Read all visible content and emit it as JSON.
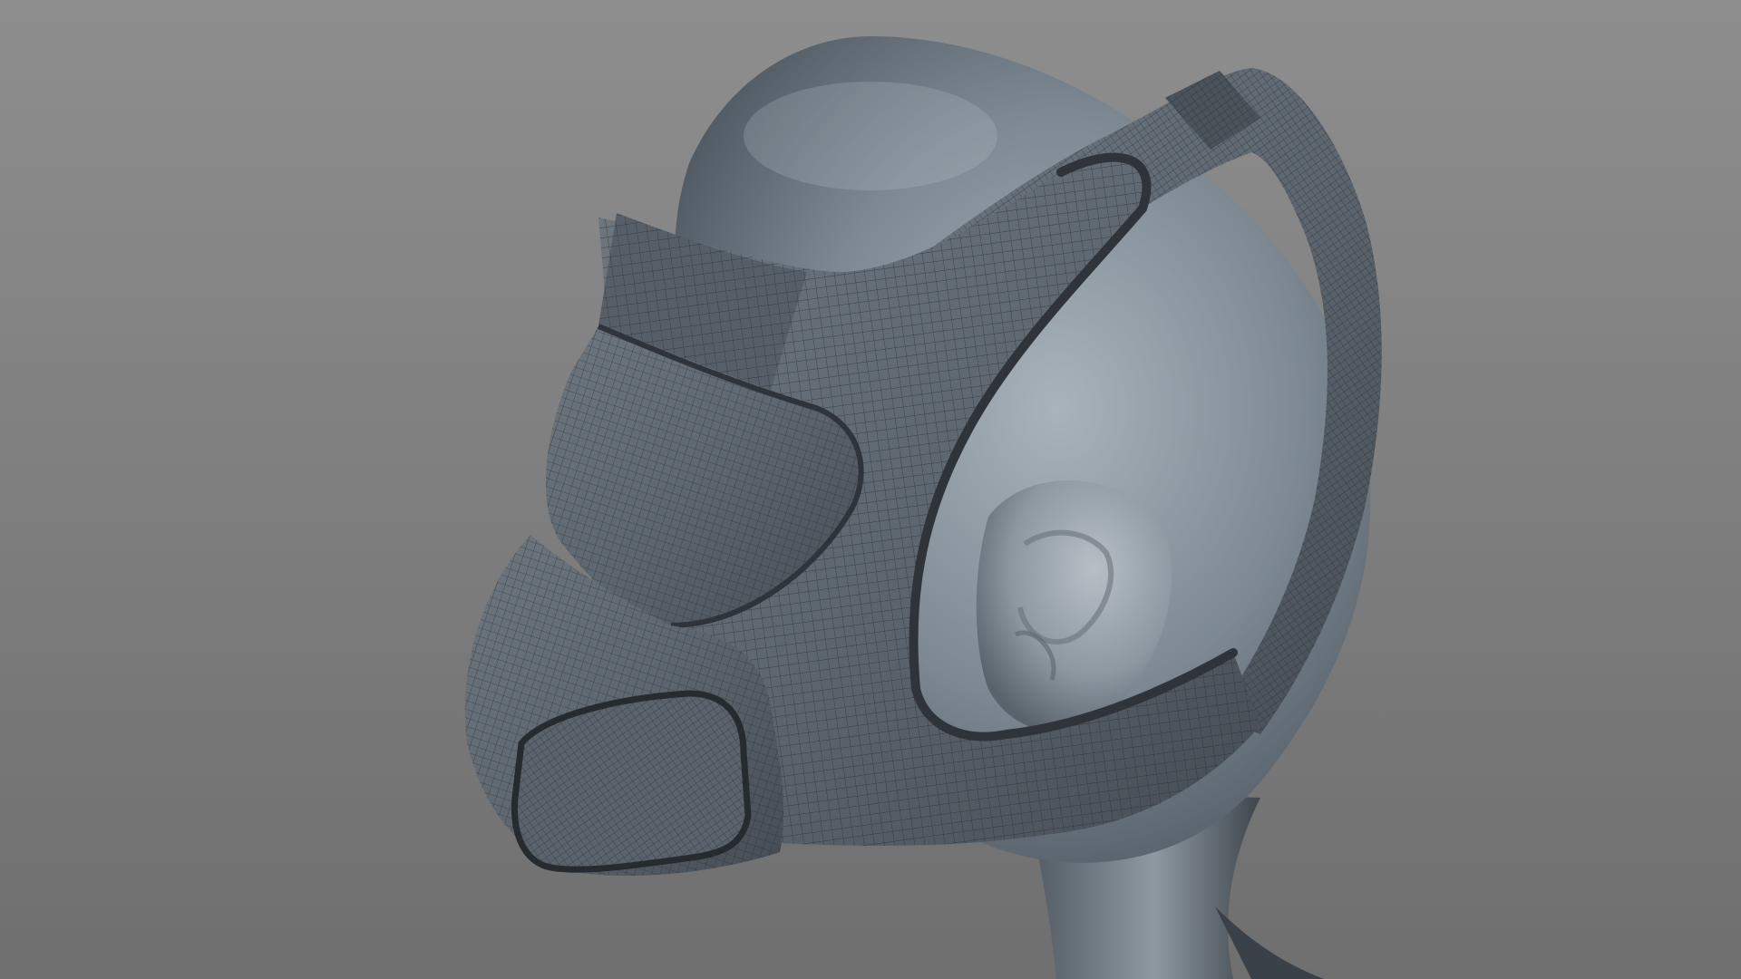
{
  "scene": {
    "description_visible_text": "",
    "colors": {
      "background_top": "#8e8e8e",
      "background_bottom": "#6f6f6f",
      "head_light": "#a4adb6",
      "head_mid": "#7d8892",
      "head_dark": "#4b545d",
      "mask_base": "#5e6770",
      "wire": "#2a2f35",
      "rim": "#3a4047"
    }
  }
}
